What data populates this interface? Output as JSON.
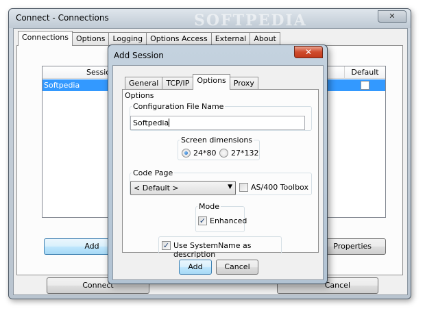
{
  "main_window": {
    "title": "Connect - Connections",
    "watermark": "SOFTPEDIA",
    "close_glyph": "✕",
    "tabs": [
      "Connections",
      "Options",
      "Logging",
      "Options Access",
      "External",
      "About"
    ],
    "active_tab": "Connections",
    "list": {
      "columns": {
        "session": "Session",
        "default": "Default"
      },
      "rows": [
        {
          "name": "Softpedia",
          "default": false
        }
      ]
    },
    "buttons": {
      "add": "Add",
      "properties": "Properties",
      "connect": "Connect",
      "cancel": "Cancel"
    }
  },
  "dialog": {
    "title": "Add Session",
    "close_glyph": "✕",
    "tabs": [
      "General",
      "TCP/IP",
      "Options",
      "Proxy"
    ],
    "active_tab": "Options",
    "options_label": "Options",
    "config_file": {
      "label": "Configuration File Name",
      "value": "Softpedia"
    },
    "screen_dimensions": {
      "label": "Screen dimensions",
      "options": [
        "24*80",
        "27*132"
      ],
      "selected": "24*80"
    },
    "code_page": {
      "label": "Code Page",
      "value": "< Default >",
      "as400_toolbox_label": "AS/400 Toolbox",
      "as400_toolbox_checked": false
    },
    "mode": {
      "label": "Mode",
      "enhanced_label": "Enhanced",
      "enhanced_checked": true
    },
    "use_systemname": {
      "label": "Use SystemName as description",
      "checked": true
    },
    "buttons": {
      "add": "Add",
      "cancel": "Cancel"
    }
  }
}
